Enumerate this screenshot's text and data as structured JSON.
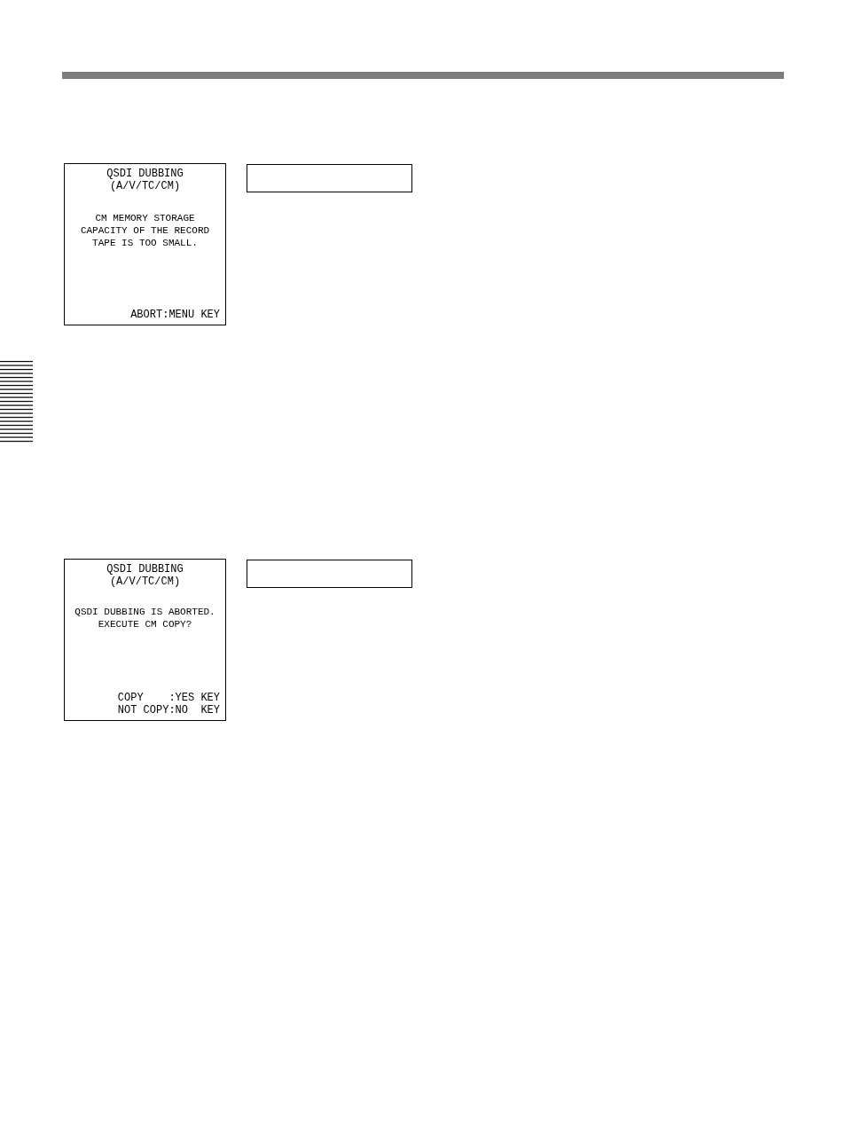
{
  "screens": [
    {
      "title": [
        "QSDI DUBBING",
        "(A/V/TC/CM)"
      ],
      "message": [
        "CM MEMORY STORAGE",
        "CAPACITY OF THE RECORD",
        "TAPE IS TOO SMALL."
      ],
      "footer": [
        "ABORT:MENU KEY"
      ]
    },
    {
      "title": [
        "QSDI DUBBING",
        "(A/V/TC/CM)"
      ],
      "message": [
        "QSDI DUBBING IS ABORTED.",
        "EXECUTE CM COPY?"
      ],
      "footer": [
        "COPY    :YES KEY",
        "NOT COPY:NO  KEY"
      ]
    }
  ]
}
